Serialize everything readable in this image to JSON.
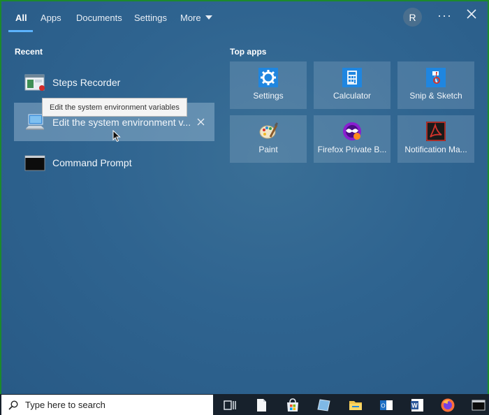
{
  "tabs": [
    {
      "label": "All",
      "active": true
    },
    {
      "label": "Apps"
    },
    {
      "label": "Documents"
    },
    {
      "label": "Settings"
    },
    {
      "label": "More"
    }
  ],
  "account": {
    "initial": "R"
  },
  "header_actions": {
    "more_dots": "···"
  },
  "recent": {
    "title": "Recent",
    "items": [
      {
        "label": "Steps Recorder",
        "icon": "steps-recorder-icon"
      },
      {
        "label": "Edit the system environment v...",
        "icon": "system-properties-icon",
        "selected": true
      },
      {
        "label": "Command Prompt",
        "icon": "command-prompt-icon"
      }
    ],
    "tooltip": "Edit the system environment variables"
  },
  "top_apps": {
    "title": "Top apps",
    "tiles": [
      {
        "label": "Settings",
        "icon": "gear-icon"
      },
      {
        "label": "Calculator",
        "icon": "calculator-icon"
      },
      {
        "label": "Snip & Sketch",
        "icon": "snip-sketch-icon"
      },
      {
        "label": "Paint",
        "icon": "paint-palette-icon"
      },
      {
        "label": "Firefox Private B...",
        "icon": "firefox-private-icon"
      },
      {
        "label": "Notification Ma...",
        "icon": "pdf-icon"
      }
    ]
  },
  "taskbar": {
    "search_placeholder": "Type here to search",
    "icons": [
      "task-view-icon",
      "document-icon",
      "store-icon",
      "tablet-icon",
      "file-explorer-icon",
      "outlook-icon",
      "word-icon",
      "firefox-icon",
      "terminal-icon"
    ]
  },
  "colors": {
    "accent": "#5cb3ff",
    "panel": "#2f6490",
    "taskbar": "#17212c"
  }
}
